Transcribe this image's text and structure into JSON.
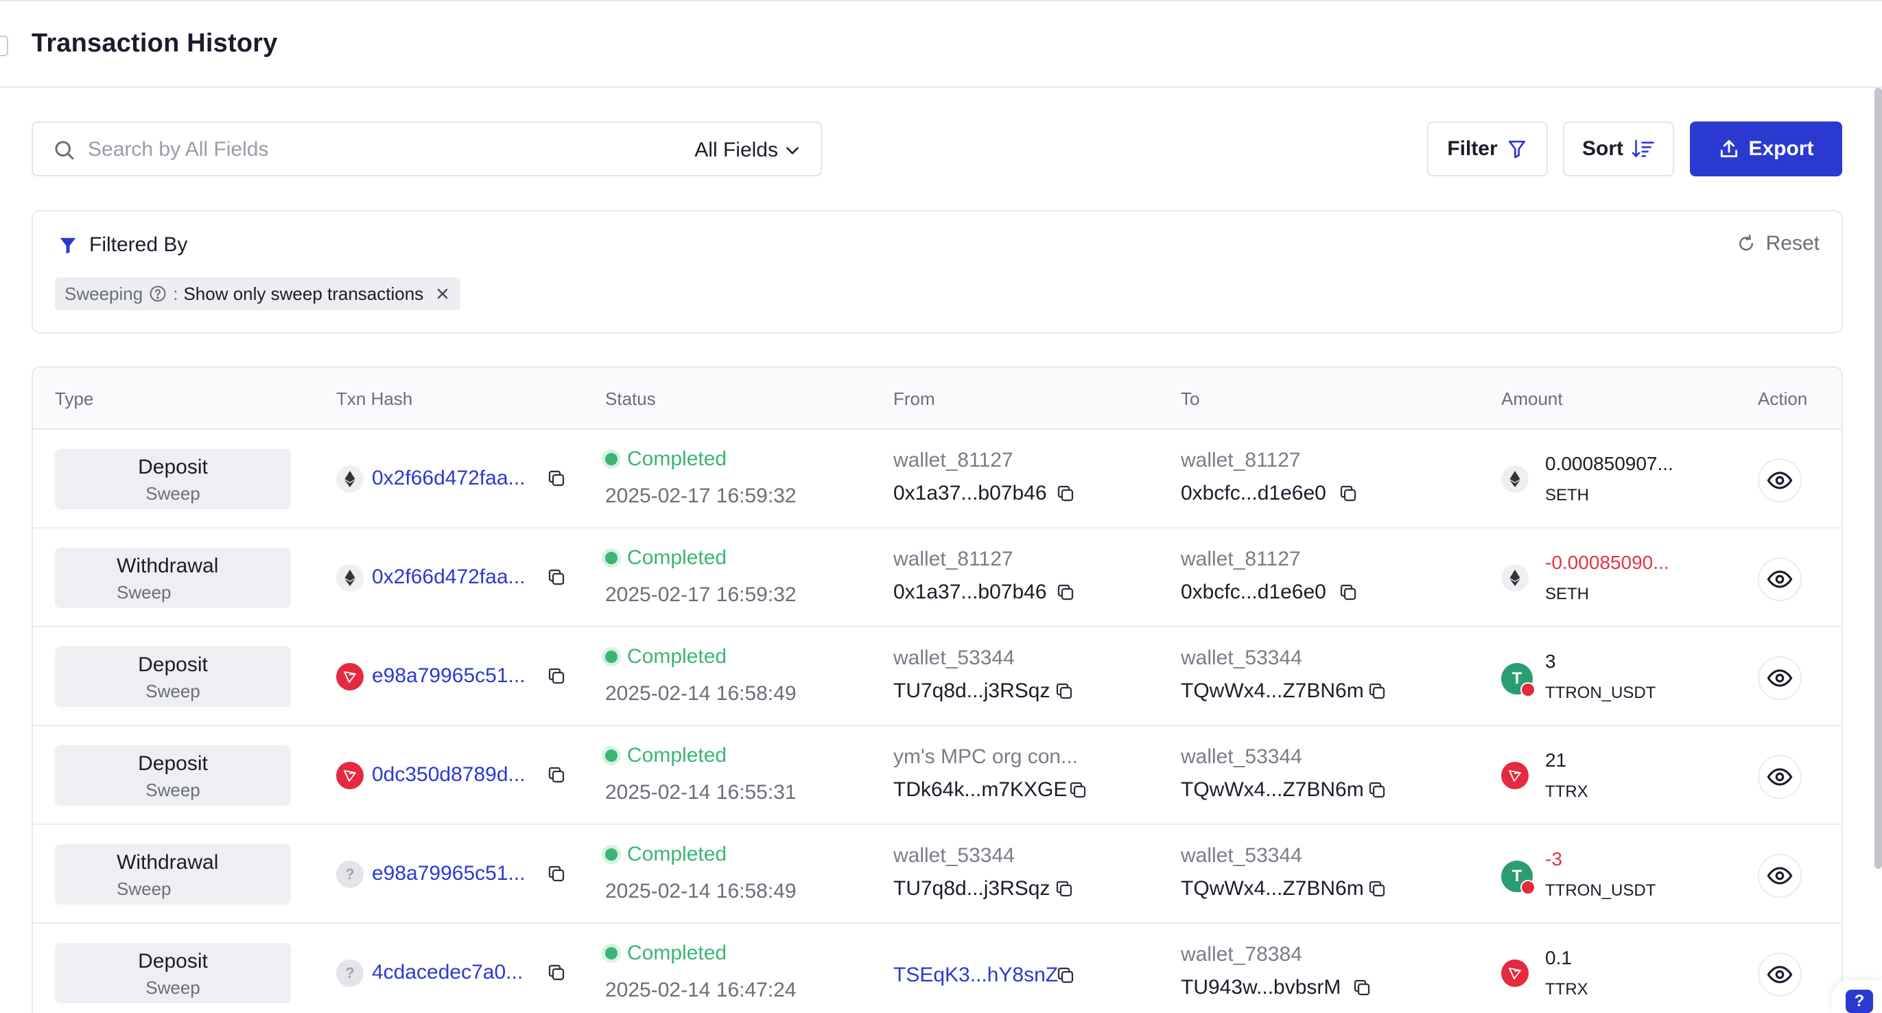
{
  "header": {
    "title": "Transaction History"
  },
  "toolbar": {
    "search_placeholder": "Search by All Fields",
    "field_select": "All Fields",
    "filter_label": "Filter",
    "sort_label": "Sort",
    "export_label": "Export"
  },
  "filter_panel": {
    "title": "Filtered By",
    "reset_label": "Reset",
    "chip_key": "Sweeping",
    "chip_sep": ":",
    "chip_value": "Show only sweep transactions"
  },
  "table": {
    "columns": [
      "Type",
      "Txn Hash",
      "Status",
      "From",
      "To",
      "Amount",
      "Action"
    ],
    "rows": [
      {
        "type": "Deposit",
        "sub": "Sweep",
        "coin": "eth",
        "hash": "0x2f66d472faa...",
        "status": "Completed",
        "time": "2025-02-17 16:59:32",
        "from_name": "wallet_81127",
        "from_addr": "0x1a37...b07b46",
        "to_name": "wallet_81127",
        "to_addr": "0xbcfc...d1e6e0",
        "amount": "0.000850907...",
        "asset": "SETH",
        "asset_icon": "eth",
        "negative": false
      },
      {
        "type": "Withdrawal",
        "sub": "Sweep",
        "coin": "eth",
        "hash": "0x2f66d472faa...",
        "status": "Completed",
        "time": "2025-02-17 16:59:32",
        "from_name": "wallet_81127",
        "from_addr": "0x1a37...b07b46",
        "to_name": "wallet_81127",
        "to_addr": "0xbcfc...d1e6e0",
        "amount": "-0.00085090...",
        "asset": "SETH",
        "asset_icon": "eth",
        "negative": true
      },
      {
        "type": "Deposit",
        "sub": "Sweep",
        "coin": "tron",
        "hash": "e98a79965c51...",
        "status": "Completed",
        "time": "2025-02-14 16:58:49",
        "from_name": "wallet_53344",
        "from_addr": "TU7q8d...j3RSqz",
        "to_name": "wallet_53344",
        "to_addr": "TQwWx4...Z7BN6m",
        "amount": "3",
        "asset": "TTRON_USDT",
        "asset_icon": "usdt",
        "negative": false
      },
      {
        "type": "Deposit",
        "sub": "Sweep",
        "coin": "tron",
        "hash": "0dc350d8789d...",
        "status": "Completed",
        "time": "2025-02-14 16:55:31",
        "from_name": "ym's MPC org con...",
        "from_addr": "TDk64k...m7KXGE",
        "to_name": "wallet_53344",
        "to_addr": "TQwWx4...Z7BN6m",
        "amount": "21",
        "asset": "TTRX",
        "asset_icon": "tron",
        "negative": false
      },
      {
        "type": "Withdrawal",
        "sub": "Sweep",
        "coin": "unknown",
        "hash": "e98a79965c51...",
        "status": "Completed",
        "time": "2025-02-14 16:58:49",
        "from_name": "wallet_53344",
        "from_addr": "TU7q8d...j3RSqz",
        "to_name": "wallet_53344",
        "to_addr": "TQwWx4...Z7BN6m",
        "amount": "-3",
        "asset": "TTRON_USDT",
        "asset_icon": "usdt",
        "negative": true
      },
      {
        "type": "Deposit",
        "sub": "Sweep",
        "coin": "unknown",
        "hash": "4cdacedec7a0...",
        "status": "Completed",
        "time": "2025-02-14 16:47:24",
        "from_name": "",
        "from_addr": "TSEqK3...hY8snZ",
        "from_is_link": true,
        "to_name": "wallet_78384",
        "to_addr": "TU943w...bvbsrM",
        "amount": "0.1",
        "asset": "TTRX",
        "asset_icon": "tron",
        "negative": false
      }
    ]
  },
  "help": {
    "label": "?"
  },
  "colors": {
    "accent": "#2a3ad1",
    "success": "#3bb573",
    "negative": "#e0363f"
  }
}
